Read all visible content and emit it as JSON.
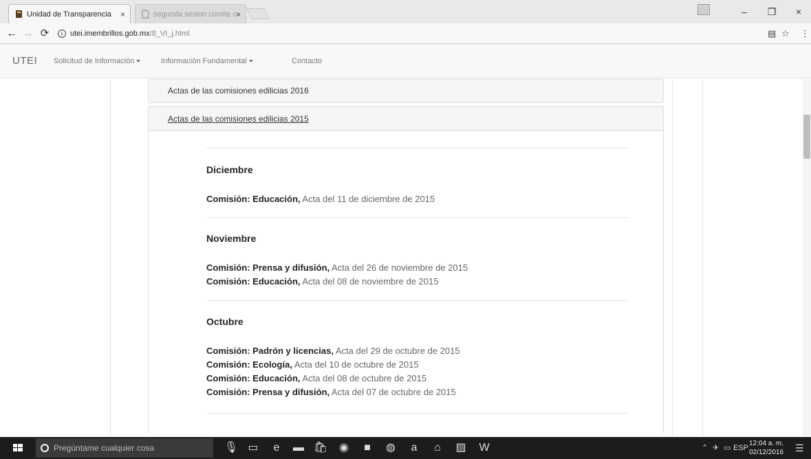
{
  "browser": {
    "tabs": [
      {
        "label": "Unidad de Transparencia",
        "active": true
      },
      {
        "label": "segunda sesion comite c",
        "active": false
      }
    ],
    "tab_close": "×",
    "url_host": "utei.imembrillos.gob.mx",
    "url_path": "/8_VI_j.html",
    "window_controls": {
      "minimize": "–",
      "maximize": "❐",
      "close": "×"
    }
  },
  "site": {
    "brand": "UTEI",
    "nav": [
      {
        "label": "Solicitud de Información",
        "dropdown": true
      },
      {
        "label": "Información Fundamental",
        "dropdown": true
      },
      {
        "label": "Contacto",
        "dropdown": false
      }
    ]
  },
  "panels": [
    {
      "title": "Actas de las comisiones edilicias 2016",
      "expanded": false
    },
    {
      "title": "Actas de las comisiones edilicias 2015",
      "expanded": true
    }
  ],
  "months": [
    {
      "name": "Diciembre",
      "actas": [
        {
          "comision": "Comisión: Educación,",
          "desc": "Acta del 11 de diciembre de 2015"
        }
      ]
    },
    {
      "name": "Noviembre",
      "actas": [
        {
          "comision": "Comisión: Prensa y difusión,",
          "desc": "Acta del 26 de noviembre de 2015"
        },
        {
          "comision": "Comisión: Educación,",
          "desc": "Acta del 08 de noviembre de 2015"
        }
      ]
    },
    {
      "name": "Octubre",
      "actas": [
        {
          "comision": "Comisión: Padrón y licencias,",
          "desc": "Acta del 29 de octubre de 2015"
        },
        {
          "comision": "Comisión: Ecología,",
          "desc": "Acta del 10 de octubre de 2015"
        },
        {
          "comision": "Comisión: Educación,",
          "desc": "Acta del 08 de octubre de 2015"
        },
        {
          "comision": "Comisión: Prensa y difusión,",
          "desc": "Acta del 07 de octubre de 2015"
        }
      ]
    }
  ],
  "taskbar": {
    "search_placeholder": "Pregúntame cualquier cosa",
    "language": "ESP",
    "time": "12:04 a. m.",
    "date": "02/12/2016"
  }
}
